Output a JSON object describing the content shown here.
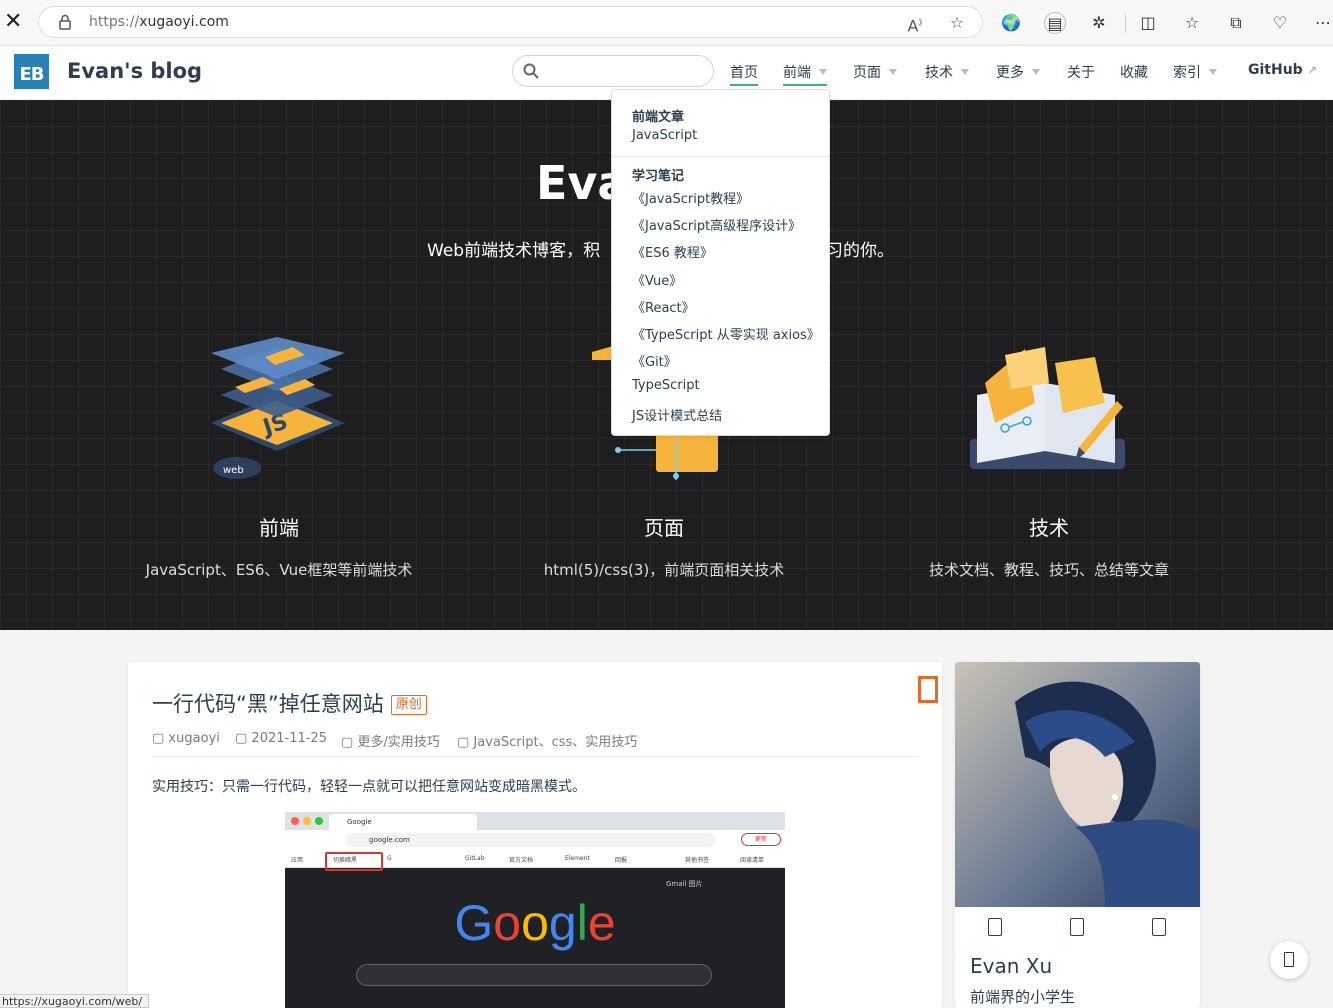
{
  "browser": {
    "url_scheme": "https://",
    "url_host": "xugaoyi.com",
    "status_url": "https://xugaoyi.com/web/"
  },
  "site": {
    "logo_text": "EB",
    "name": "Evan's blog",
    "search_placeholder": ""
  },
  "nav": {
    "home": "首页",
    "frontend": "前端",
    "pages": "页面",
    "tech": "技术",
    "more": "更多",
    "about": "关于",
    "favorites": "收藏",
    "index": "索引",
    "github": "GitHub"
  },
  "dropdown": {
    "group1_title": "前端文章",
    "group1_items": [
      "JavaScript"
    ],
    "group2_title": "学习笔记",
    "group2_items": [
      "《JavaScript教程》",
      "《JavaScript高级程序设计》",
      "《ES6 教程》",
      "《Vue》",
      "《React》",
      "《TypeScript 从零实现 axios》",
      "《Git》",
      "TypeScript",
      "JS设计模式总结"
    ]
  },
  "hero": {
    "title": "Eva",
    "desc_left": "Web前端技术博客，积",
    "desc_right": "习的你。",
    "features": [
      {
        "title": "前端",
        "desc": "JavaScript、ES6、Vue框架等前端技术",
        "icon": "js-layers-icon"
      },
      {
        "title": "页面",
        "desc": "html(5)/css(3)，前端页面相关技术",
        "icon": "page-box-icon"
      },
      {
        "title": "技术",
        "desc": "技术文档、教程、技巧、总结等文章",
        "icon": "book-pencil-icon"
      }
    ]
  },
  "post": {
    "title": "一行代码“黑”掉任意网站",
    "badge": "原创",
    "author": "xugaoyi",
    "date": "2021-11-25",
    "category": "更多/实用技巧",
    "tags": "JavaScript、css、实用技巧",
    "summary": "实用技巧：只需一行代码，轻轻一点就可以把任意网站变成暗黑模式。",
    "screenshot": {
      "tab_title": "Google",
      "address": "google.com",
      "update_label": "更新",
      "bookmarks": [
        "应用",
        "切换暗黑",
        "G",
        "GitLab",
        "官方文档",
        "Element",
        "回报",
        "其他书签",
        "阅读清单"
      ],
      "top_links": "Gmail  图片",
      "logo_text": "Google"
    }
  },
  "profile": {
    "name": "Evan Xu",
    "bio": "前端界的小学生"
  },
  "colors": {
    "accent": "#3eaf7c",
    "badge": "#e8672d",
    "hero_bg": "#1e1e20"
  }
}
